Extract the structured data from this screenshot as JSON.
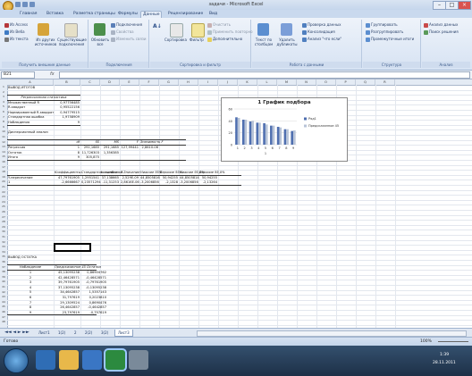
{
  "window": {
    "title": "задачи - Microsoft Excel",
    "controls": [
      "–",
      "□",
      "×"
    ]
  },
  "tabs": [
    "Главная",
    "Вставка",
    "Разметка страницы",
    "Формулы",
    "Данные",
    "Рецензирование",
    "Вид"
  ],
  "active_tab": "Данные",
  "ribbon": {
    "groups": [
      {
        "label": "Получить внешние данные",
        "items": [
          "Из Access",
          "Из Веба",
          "Из текста",
          "Из других источников",
          "Существующие подключения"
        ]
      },
      {
        "label": "Подключения",
        "items": [
          "Обновить все",
          "Подключения",
          "Свойства",
          "Изменить связи"
        ]
      },
      {
        "label": "Сортировка и фильтр",
        "items": [
          "Сортировка",
          "Фильтр",
          "Очистить",
          "Применить повторно",
          "Дополнительно"
        ]
      },
      {
        "label": "Работа с данными",
        "items": [
          "Текст по столбцам",
          "Удалить дубликаты",
          "Проверка данных",
          "Консолидация",
          "Анализ \"что если\""
        ]
      },
      {
        "label": "Структура",
        "items": [
          "Группировать",
          "Разгруппировать",
          "Промежуточные итоги"
        ]
      },
      {
        "label": "Анализ",
        "items": [
          "Анализ данных",
          "Поиск решения"
        ]
      }
    ]
  },
  "formula_bar": {
    "name_box": "B21",
    "fx": "fx",
    "value": ""
  },
  "columns": [
    "A",
    "B",
    "C",
    "D",
    "E",
    "F",
    "G",
    "H",
    "I",
    "J",
    "K",
    "L",
    "M",
    "N",
    "O",
    "P",
    "Q",
    "R"
  ],
  "cells": {
    "r1": "ВЫВОД ИТОГОВ",
    "reg_header": "Регрессионная статистика",
    "stats": [
      {
        "label": "Множественный R",
        "value": "0,97756485"
      },
      {
        "label": "R-квадрат",
        "value": "0,95522156"
      },
      {
        "label": "Нормированный R-квадрат",
        "value": "0,94779515"
      },
      {
        "label": "Стандартная ошибка",
        "value": "1,9758909"
      },
      {
        "label": "Наблюдения",
        "value": "9"
      }
    ],
    "anova_title": "Дисперсионный анализ",
    "anova_header": [
      "df",
      "SS",
      "MS",
      "F",
      "Значимость F"
    ],
    "anova_rows": [
      {
        "label": "Регрессия",
        "vals": [
          "1",
          "291,1685",
          "291,1685",
          "127,99441",
          "2,8610-06"
        ]
      },
      {
        "label": "Остаток",
        "vals": [
          "8",
          "11,726303",
          "1,356385",
          "",
          ""
        ]
      },
      {
        "label": "Итого",
        "vals": [
          "9",
          "305,875",
          "",
          "",
          ""
        ]
      }
    ],
    "coef_header": [
      "Коэффициенты",
      "Стандартная ошибка",
      "t-статистика",
      "P-Значение",
      "Нижние 95%",
      "Верхние 95%",
      "Нижние 95,0%",
      "Верхние 95,0%"
    ],
    "coef_rows": [
      {
        "label": "Y-пересечение",
        "vals": [
          "47,79761905",
          "1,2951541",
          "37,138665",
          "2,529E-09",
          "44,8505816",
          "50,94255",
          "44,8505814",
          "50,94255"
        ]
      },
      {
        "label": "1",
        "vals": [
          "-2,6666667",
          "0,23571294",
          "-11,31253",
          "2,8616E-06",
          "-3,2006856",
          "-2,1328",
          "-3,2006856",
          "-2,13264"
        ]
      }
    ],
    "resid_title": "ВЫВОД ОСТАТКА",
    "resid_header": [
      "Наблюдение",
      "Предсказанное 45",
      "Остатки"
    ],
    "resid_rows": [
      [
        "1",
        "45,13095238",
        "0,86904762"
      ],
      [
        "2",
        "42,46428571",
        "-0,46428571"
      ],
      [
        "3",
        "39,79761905",
        "-0,79761905"
      ],
      [
        "4",
        "37,13095238",
        "-0,13095238"
      ],
      [
        "5",
        "34,4642857",
        "1,5357143"
      ],
      [
        "6",
        "31,797619",
        "0,2023810"
      ],
      [
        "7",
        "29,1309524",
        "0,8690476"
      ],
      [
        "8",
        "26,4642857",
        "-0,4642857"
      ],
      [
        "9",
        "23,797619",
        "-0,797619"
      ]
    ]
  },
  "chart_data": {
    "type": "bar",
    "title": "1 График подбора",
    "categories": [
      "1",
      "2",
      "3",
      "4",
      "5",
      "6",
      "7",
      "8",
      "9"
    ],
    "ylim": [
      0,
      60
    ],
    "yticks": [
      "0",
      "20",
      "40",
      "60"
    ],
    "xlabel": "1",
    "series": [
      {
        "name": "Ряд1",
        "values": [
          46,
          42,
          39,
          37,
          36,
          32,
          30,
          26,
          23
        ]
      },
      {
        "name": "Предсказанное 45",
        "values": [
          45,
          42,
          40,
          37,
          34,
          32,
          29,
          26,
          24
        ]
      }
    ],
    "colors": [
      "#4f6fb0",
      "#b8c4d8"
    ]
  },
  "sheet_tabs": [
    "Лист1",
    "1(2)",
    "2",
    "2(2)",
    "3(2)",
    "Лист3"
  ],
  "active_sheet": "Лист3",
  "status": {
    "ready": "Готово",
    "zoom": "100%"
  },
  "taskbar": {
    "time": "1:39",
    "date": "28.11.2011"
  }
}
